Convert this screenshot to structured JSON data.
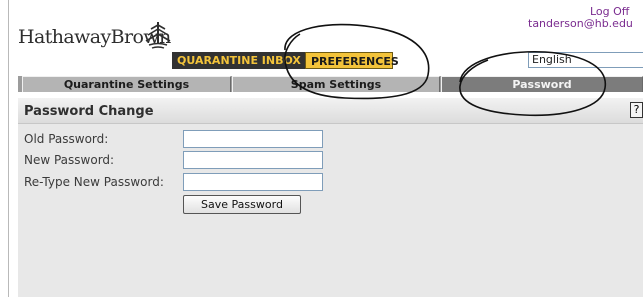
{
  "brand": {
    "logo_text": "HathawayBrown",
    "logo_icon": "stylized-tree-icon"
  },
  "header": {
    "tabs": [
      {
        "label": "QUARANTINE INBOX",
        "active": false
      },
      {
        "label": "PREFERENCES",
        "active": true
      }
    ],
    "log_off": "Log Off",
    "user_email": "tanderson@hb.edu",
    "language": {
      "selected": "English",
      "icon": "chevron-down-icon"
    }
  },
  "subtabs": [
    {
      "label": "Quarantine Settings",
      "active": false
    },
    {
      "label": "Spam Settings",
      "active": false
    },
    {
      "label": "Password",
      "active": true
    }
  ],
  "panel": {
    "title": "Password Change",
    "help_label": "?",
    "fields": {
      "old_password": {
        "label": "Old Password:",
        "value": ""
      },
      "new_password": {
        "label": "New Password:",
        "value": ""
      },
      "retype_password": {
        "label": "Re-Type New Password:",
        "value": ""
      }
    },
    "save_label": "Save Password"
  },
  "colors": {
    "tab_dark": "#323232",
    "tab_gold": "#f3c33a",
    "link_purple": "#7a2b8f",
    "subtab_active": "#7c7c7c",
    "panel_bg": "#e8e8e8"
  }
}
